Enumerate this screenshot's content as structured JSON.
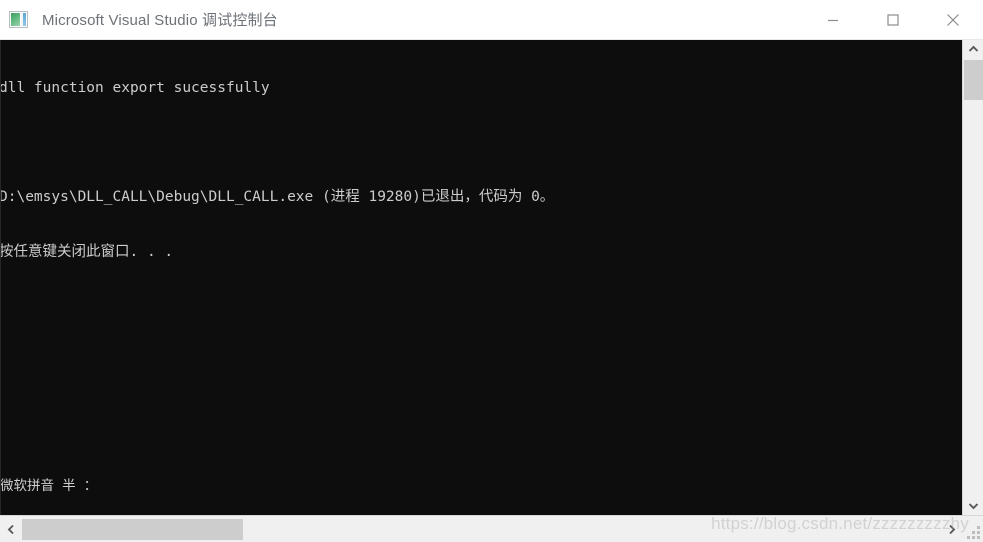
{
  "window": {
    "title": "Microsoft Visual Studio 调试控制台",
    "icon": "console-app-icon",
    "controls": {
      "minimize_label": "—",
      "maximize_label": "□",
      "close_label": "✕"
    }
  },
  "console": {
    "background_color": "#0d0d0d",
    "text_color": "#cccccc",
    "lines": [
      "dll function export sucessfully",
      "",
      "D:\\emsys\\DLL_CALL\\Debug\\DLL_CALL.exe (进程 19280)已退出，代码为 0。",
      "按任意键关闭此窗口. . ."
    ],
    "ime_status": "微软拼音 半 ："
  },
  "scrollbars": {
    "vertical": {
      "up_arrow": "▲",
      "down_arrow": "▼"
    },
    "horizontal": {
      "left_arrow": "◀",
      "right_arrow": "▶"
    }
  },
  "watermark": {
    "text": "https://blog.csdn.net/zzzzzzzzzhy"
  }
}
